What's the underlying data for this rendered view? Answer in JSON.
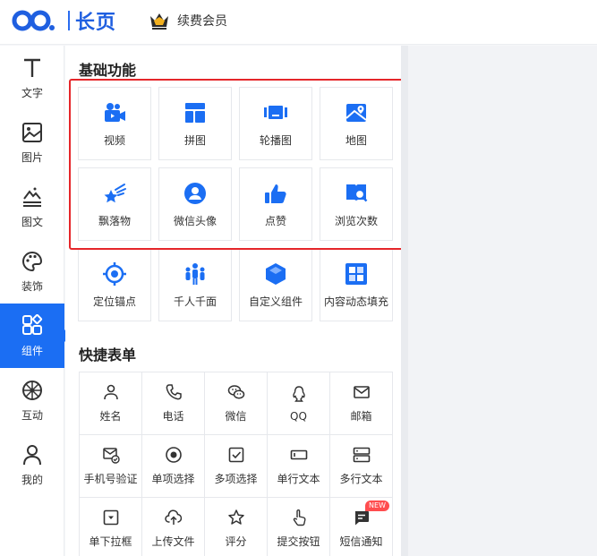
{
  "header": {
    "brand_text": "长页",
    "renew_label": "续费会员"
  },
  "rail": [
    {
      "label": "文字",
      "icon": "text-icon"
    },
    {
      "label": "图片",
      "icon": "image-icon"
    },
    {
      "label": "图文",
      "icon": "image-text-icon"
    },
    {
      "label": "装饰",
      "icon": "palette-icon"
    },
    {
      "label": "组件",
      "icon": "component-icon",
      "active": true
    },
    {
      "label": "互动",
      "icon": "wheel-icon"
    },
    {
      "label": "我的",
      "icon": "user-icon"
    }
  ],
  "basic": {
    "title": "基础功能",
    "items": [
      {
        "label": "视频",
        "icon": "video-camera-icon"
      },
      {
        "label": "拼图",
        "icon": "collage-icon"
      },
      {
        "label": "轮播图",
        "icon": "carousel-icon"
      },
      {
        "label": "地图",
        "icon": "map-icon"
      },
      {
        "label": "飘落物",
        "icon": "shooting-star-icon"
      },
      {
        "label": "微信头像",
        "icon": "avatar-icon"
      },
      {
        "label": "点赞",
        "icon": "thumbs-up-icon"
      },
      {
        "label": "浏览次数",
        "icon": "view-count-icon"
      },
      {
        "label": "定位锚点",
        "icon": "anchor-target-icon"
      },
      {
        "label": "千人千面",
        "icon": "crowd-icon"
      },
      {
        "label": "自定义组件",
        "icon": "cube-icon"
      },
      {
        "label": "内容动态填充",
        "icon": "dynamic-fill-icon"
      }
    ]
  },
  "form": {
    "title": "快捷表单",
    "items": [
      {
        "label": "姓名",
        "icon": "person-icon"
      },
      {
        "label": "电话",
        "icon": "phone-icon"
      },
      {
        "label": "微信",
        "icon": "wechat-icon"
      },
      {
        "label": "QQ",
        "icon": "qq-icon"
      },
      {
        "label": "邮箱",
        "icon": "mail-icon"
      },
      {
        "label": "手机号验证",
        "icon": "verify-mail-icon"
      },
      {
        "label": "单项选择",
        "icon": "radio-icon"
      },
      {
        "label": "多项选择",
        "icon": "checkbox-icon"
      },
      {
        "label": "单行文本",
        "icon": "single-line-icon"
      },
      {
        "label": "多行文本",
        "icon": "multi-line-icon"
      },
      {
        "label": "单下拉框",
        "icon": "dropdown-icon"
      },
      {
        "label": "上传文件",
        "icon": "upload-icon"
      },
      {
        "label": "评分",
        "icon": "star-icon"
      },
      {
        "label": "提交按钮",
        "icon": "tap-icon"
      },
      {
        "label": "短信通知",
        "icon": "sms-icon",
        "badge": "NEW"
      }
    ]
  },
  "colors": {
    "accent": "#1b6ef3",
    "highlight": "#e5262a"
  }
}
